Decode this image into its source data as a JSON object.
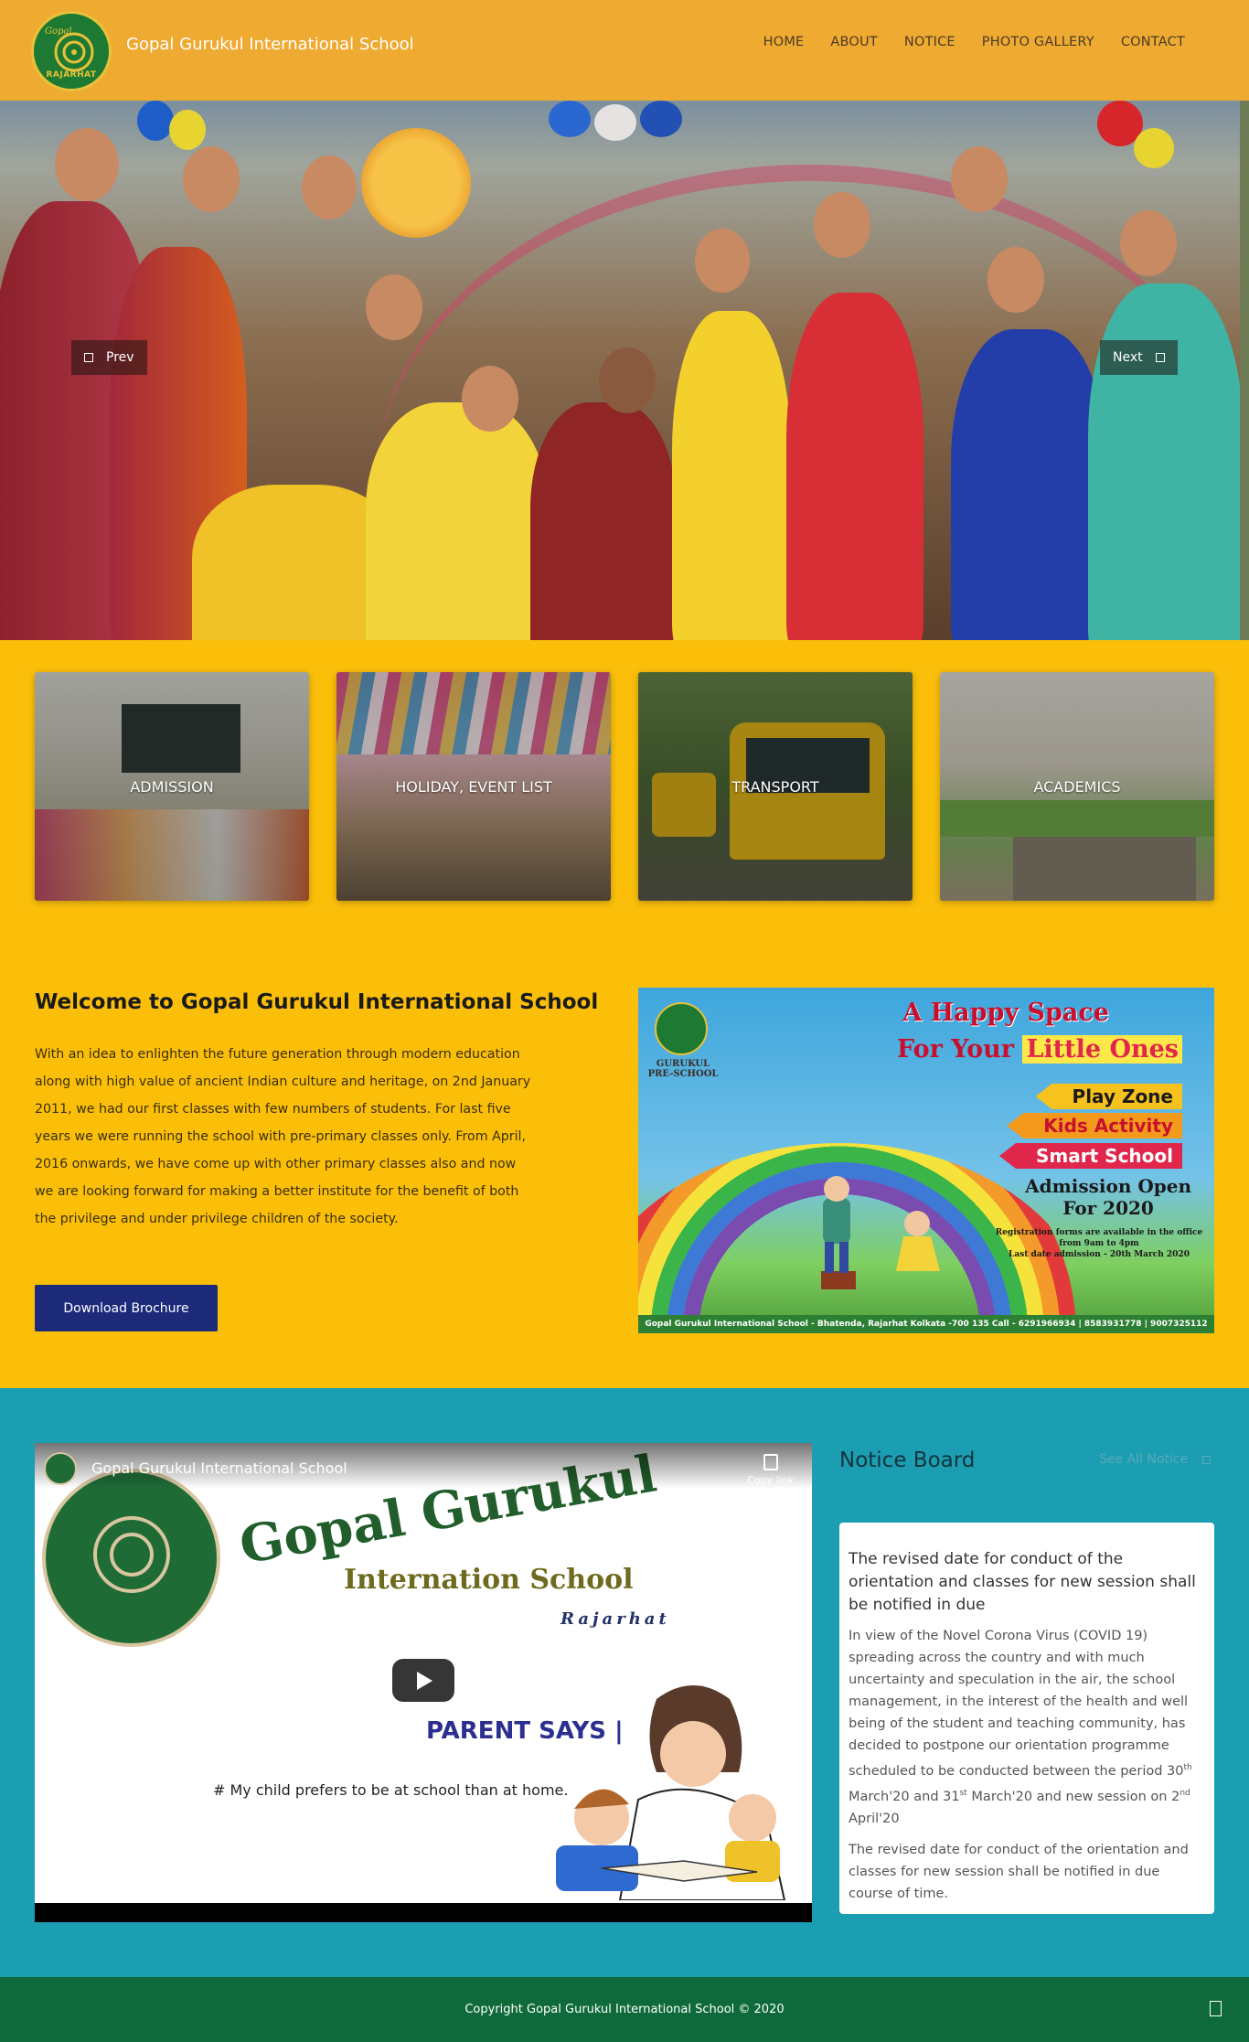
{
  "header": {
    "logo_top": "Gopal",
    "logo_sub": "RAJARHAT",
    "site_title": "Gopal Gurukul International School",
    "nav": [
      "HOME",
      "ABOUT",
      "NOTICE",
      "PHOTO GALLERY",
      "CONTACT"
    ]
  },
  "slider": {
    "prev_label": "Prev",
    "next_label": "Next"
  },
  "features": [
    {
      "label": "ADMISSION"
    },
    {
      "label": "HOLIDAY, EVENT LIST"
    },
    {
      "label": "TRANSPORT"
    },
    {
      "label": "ACADEMICS"
    }
  ],
  "welcome": {
    "title": "Welcome to Gopal Gurukul International School",
    "text": "With an idea to enlighten the future generation through modern education along with high value of ancient Indian culture and heritage, on 2nd January 2011, we had our first classes with few numbers of students. For last five years we were running the school with pre-primary classes only. From April, 2016 onwards, we have come up with other primary classes also and now we are looking forward for making a better institute for the benefit of both the privilege and under privilege children of the society.",
    "button": "Download Brochure"
  },
  "poster": {
    "pre_school": "GURUKUL PRE-SCHOOL",
    "line1": "A Happy Space",
    "line2_a": "For Your",
    "line2_b": "Little Ones",
    "tags": [
      {
        "text": "Play Zone",
        "bg": "#f7c21d",
        "color": "#1a1a1a"
      },
      {
        "text": "Kids Activity",
        "bg": "#f39a1c",
        "color": "#c8102e"
      },
      {
        "text": "Smart School",
        "bg": "#e0264b",
        "color": "#ffffff"
      }
    ],
    "admission": "Admission Open",
    "year": "For 2020",
    "note1": "Registration forms are available in the office",
    "note2": "from 9am to 4pm",
    "note3": "Last date admission - 20th March 2020",
    "footer": "Gopal Gurukul International School - Bhatenda, Rajarhat Kolkata -700 135  Call - 6291966934 | 8583931778 | 9007325112"
  },
  "video": {
    "channel": "Gopal Gurukul International School",
    "copy_link": "Copy link",
    "title1": "Gopal Gurukul",
    "title2": "Internation School",
    "title3": "Rajarhat",
    "parent_says": "PARENT SAYS |",
    "quote": "# My child prefers to be at school than at home."
  },
  "notice": {
    "title": "Notice Board",
    "see_all": "See All Notice",
    "headline": "The revised date for conduct of the orientation and classes for new session shall be notified in due",
    "body_1a": "In view of the Novel Corona Virus (COVID 19) spreading across the country and with much uncertainty and speculation in the air, the school management, in the interest of the health and well being of the student and teaching community, has decided to postpone our orientation programme scheduled to be conducted between the period 30",
    "sup_1": "th",
    "body_1b": " March'20 and 31",
    "sup_2": "st",
    "body_1c": " March'20 and new session on 2",
    "sup_3": "nd",
    "body_1d": " April'20",
    "body_2": "The revised date for conduct of the orientation and classes for new session shall be notified in due course of time."
  },
  "footer": {
    "copyright": "Copyright Gopal Gurukul International School © 2020"
  },
  "colors": {
    "header_bg": "#efaa32",
    "feature_bg": "#fbbf0a",
    "teal_bg": "#1b9db2",
    "footer_bg": "#0e6a3a",
    "button_bg": "#1d2a7a"
  }
}
